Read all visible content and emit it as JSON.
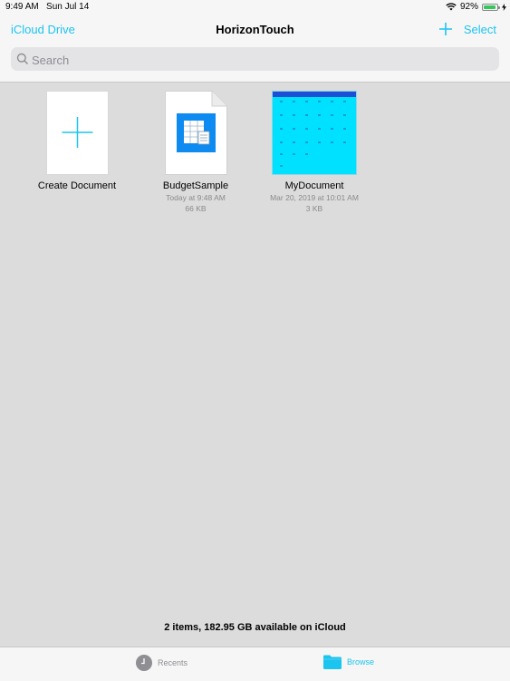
{
  "status": {
    "time": "9:49 AM",
    "date": "Sun Jul 14",
    "battery": "92%",
    "battery_fraction": 0.92
  },
  "nav": {
    "back_label": "iCloud Drive",
    "title": "HorizonTouch",
    "select_label": "Select"
  },
  "search": {
    "placeholder": "Search"
  },
  "items": [
    {
      "name": "Create Document"
    },
    {
      "name": "BudgetSample",
      "modified": "Today at 9:48 AM",
      "size": "66 KB"
    },
    {
      "name": "MyDocument",
      "modified": "Mar 20, 2019 at 10:01 AM",
      "size": "3 KB"
    }
  ],
  "footer": {
    "text": "2 items, 182.95 GB available on iCloud"
  },
  "tabs": {
    "recents": "Recents",
    "browse": "Browse"
  },
  "colors": {
    "accent": "#1cc4f0",
    "background": "#dcdcdc",
    "bar": "#f6f6f6",
    "mydoc_fill": "#00e0ff"
  }
}
